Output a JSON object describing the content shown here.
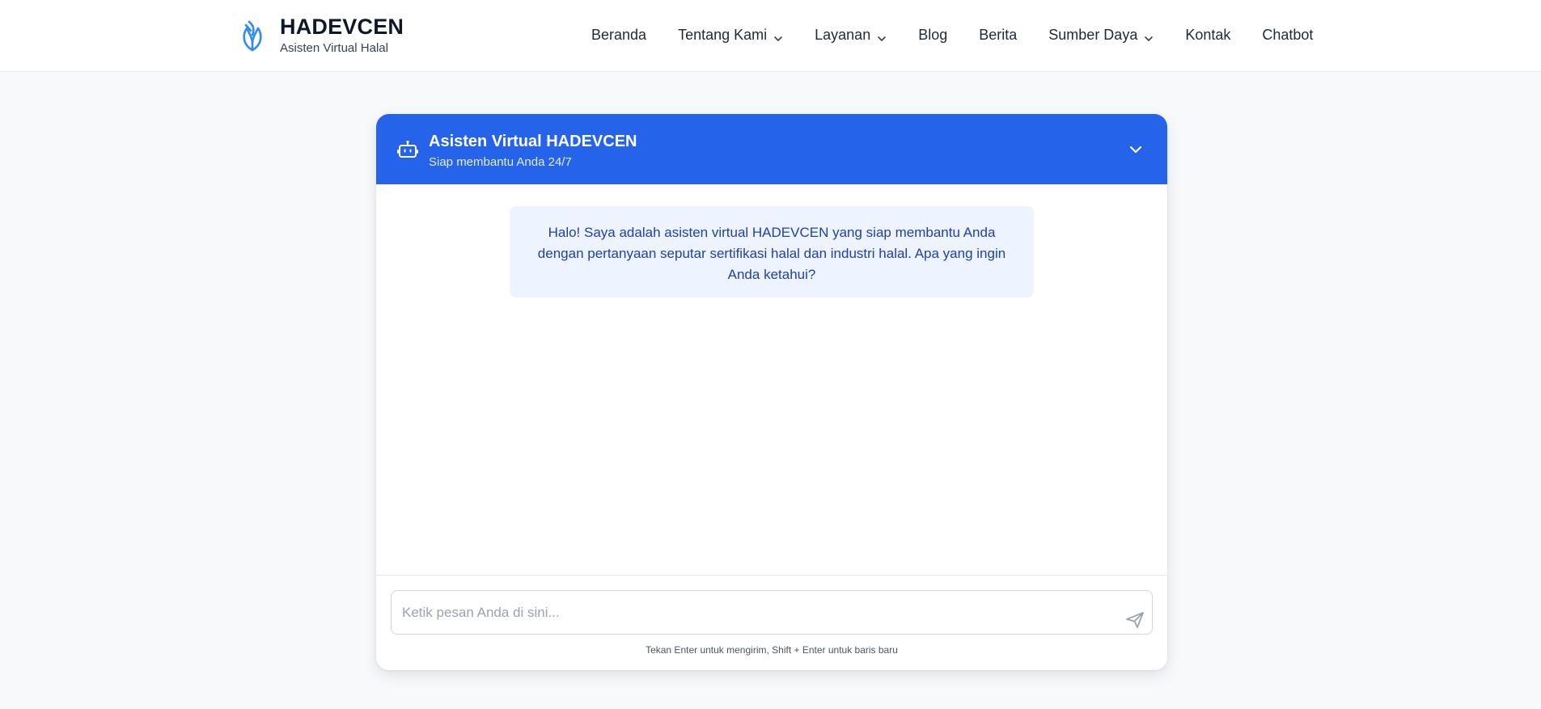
{
  "brand": {
    "title": "HADEVCEN",
    "subtitle": "Asisten Virtual Halal",
    "logo_icon": "leaf-logo-icon"
  },
  "nav": {
    "items": [
      {
        "label": "Beranda",
        "has_dropdown": false
      },
      {
        "label": "Tentang Kami",
        "has_dropdown": true
      },
      {
        "label": "Layanan",
        "has_dropdown": true
      },
      {
        "label": "Blog",
        "has_dropdown": false
      },
      {
        "label": "Berita",
        "has_dropdown": false
      },
      {
        "label": "Sumber Daya",
        "has_dropdown": true
      },
      {
        "label": "Kontak",
        "has_dropdown": false
      },
      {
        "label": "Chatbot",
        "has_dropdown": false
      }
    ]
  },
  "chat": {
    "title": "Asisten Virtual HADEVCEN",
    "subtitle": "Siap membantu Anda 24/7",
    "header_icon": "robot-icon",
    "collapse_icon": "chevron-down-icon",
    "messages": [
      {
        "role": "bot",
        "text": "Halo! Saya adalah asisten virtual HADEVCEN yang siap membantu Anda dengan pertanyaan seputar sertifikasi halal dan industri halal. Apa yang ingin Anda ketahui?"
      }
    ],
    "input": {
      "placeholder": "Ketik pesan Anda di sini...",
      "value": ""
    },
    "send_icon": "send-icon",
    "hint": "Tekan Enter untuk mengirim, Shift + Enter untuk baris baru"
  },
  "colors": {
    "primary": "#2563eb",
    "page_bg": "#f8f9fb",
    "bubble_bg": "#eef4ff",
    "bubble_text": "#1e40af",
    "logo": "#2f8cf0"
  }
}
